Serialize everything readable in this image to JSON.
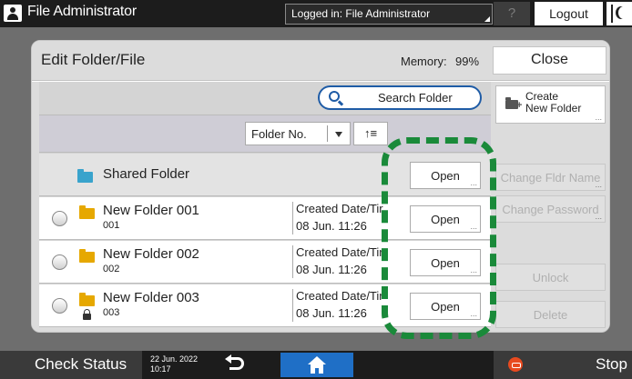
{
  "topbar": {
    "title": "File Administrator",
    "login_status": "Logged in: File Administrator",
    "help_label": "?",
    "logout_label": "Logout"
  },
  "dialog": {
    "title": "Edit Folder/File",
    "memory_label": "Memory:",
    "memory_value": "99%",
    "close_label": "Close",
    "search_label": "Search Folder",
    "sort": {
      "selected": "Folder No.",
      "order_label": "↑≡"
    },
    "shared_folder": {
      "name": "Shared Folder",
      "open_label": "Open",
      "dots": "..."
    },
    "folders": [
      {
        "name": "New Folder 001",
        "number": "001",
        "created_label": "Created Date/Tir",
        "created_value": "08 Jun.  11:26",
        "open_label": "Open",
        "dots": "...",
        "locked": false
      },
      {
        "name": "New Folder 002",
        "number": "002",
        "created_label": "Created Date/Tir",
        "created_value": "08 Jun.  11:26",
        "open_label": "Open",
        "dots": "...",
        "locked": false
      },
      {
        "name": "New Folder 003",
        "number": "003",
        "created_label": "Created Date/Tir",
        "created_value": "08 Jun.  11:26",
        "open_label": "Open",
        "dots": "...",
        "locked": true
      }
    ],
    "side_buttons": {
      "create_line1": "Create",
      "create_line2": "New Folder",
      "create_dots": "...",
      "change_name": "Change Fldr Name",
      "change_name_dots": "...",
      "change_password": "Change Password",
      "change_password_dots": "...",
      "unlock": "Unlock",
      "delete": "Delete"
    },
    "highlight_color": "#1a8a3a"
  },
  "bottombar": {
    "check_status": "Check Status",
    "date": "22 Jun. 2022",
    "time": "10:17",
    "stop_label": "Stop"
  },
  "colors": {
    "accent_blue": "#1f5ca6",
    "home_blue": "#1f6fc6",
    "stop_red": "#e84a1f",
    "folder_yellow": "#e6a800",
    "shared_folder_blue": "#39a3cc"
  }
}
